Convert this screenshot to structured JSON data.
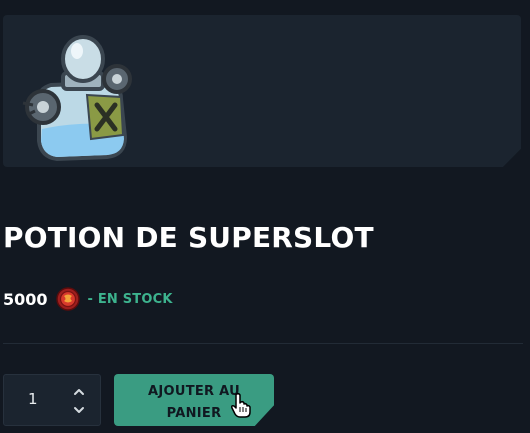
{
  "product": {
    "title": "POTION DE SUPERSLOT",
    "image_icon": "potion-bottle-icon"
  },
  "pricing": {
    "price": "5000",
    "currency_icon": "red-coin-icon",
    "stock_status": "- EN STOCK"
  },
  "cart": {
    "quantity": "1",
    "add_button_label": "AJOUTER AU PANIER"
  },
  "colors": {
    "background": "#121821",
    "card": "#1b242f",
    "accent": "#3a9c82",
    "stock": "#3db38e"
  }
}
